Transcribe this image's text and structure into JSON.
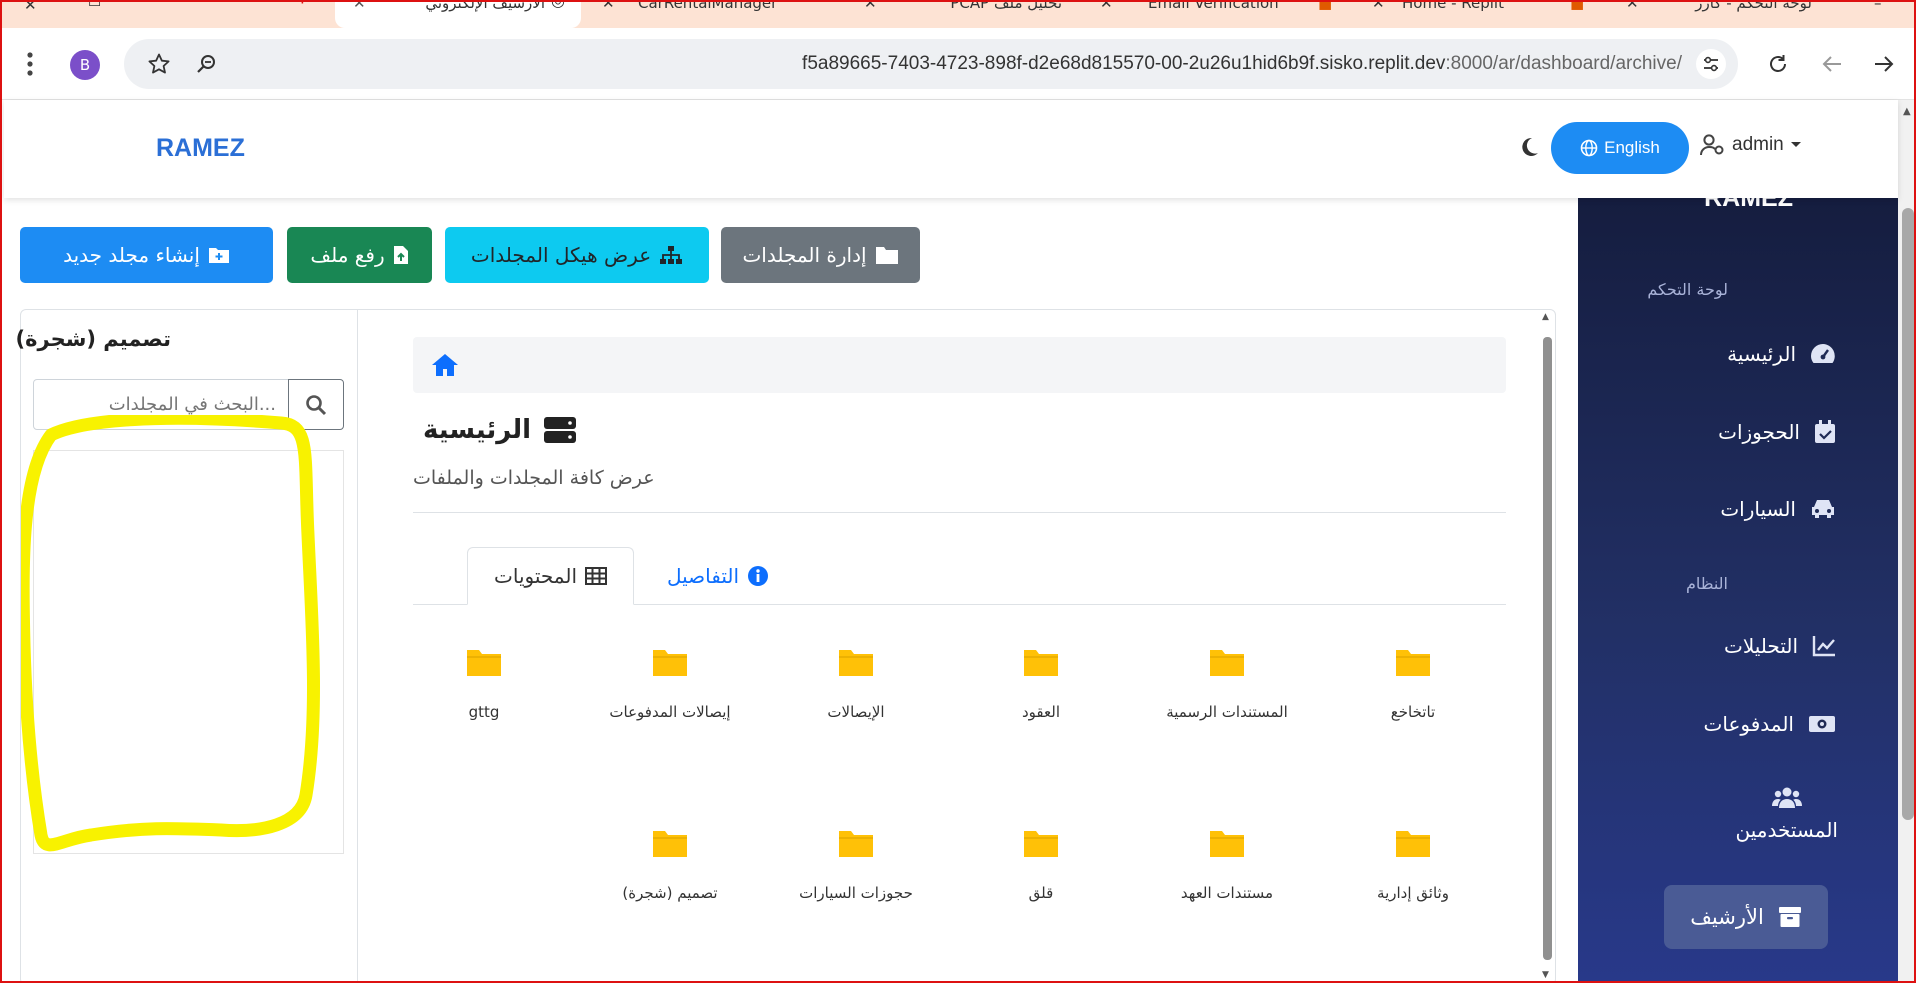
{
  "browser": {
    "tabs": [
      {
        "label": "الأرشيف الإلكتروني",
        "active": true
      },
      {
        "label": "CarRentalManager"
      },
      {
        "label": "تحليل ملف PCAP"
      },
      {
        "label": "Email Verification"
      },
      {
        "label": "Home - Replit"
      },
      {
        "label": "لوحة التحكم - كارز"
      }
    ],
    "profile_initial": "B",
    "url_host": "f5a89665-7403-4723-898f-d2e68d815570-00-2u26u1hid6b9f.sisko.replit.dev",
    "url_rest": ":8000/ar/dashboard/archive/"
  },
  "header": {
    "brand": "RAMEZ",
    "language_button": "English",
    "user_menu": "admin"
  },
  "sidebar": {
    "brand": "RAMEZ",
    "section_dashboard": "لوحة التحكم",
    "section_system": "النظام",
    "items": [
      {
        "label": "الرئيسية",
        "icon": "gauge-icon"
      },
      {
        "label": "الحجوزات",
        "icon": "calendar-check-icon"
      },
      {
        "label": "السيارات",
        "icon": "car-icon"
      },
      {
        "label": "التحليلات",
        "icon": "chart-line-icon"
      },
      {
        "label": "المدفوعات",
        "icon": "money-icon"
      },
      {
        "label": "المستخدمين",
        "icon": "users-icon"
      },
      {
        "label": "الأرشيف",
        "icon": "archive-icon",
        "active": true
      }
    ]
  },
  "toolbar": {
    "new_folder": "إنشاء مجلد جديد",
    "upload_file": "رفع ملف",
    "folder_structure": "عرض هيكل المجلدات",
    "manage_folders": "إدارة المجلدات"
  },
  "tree_panel": {
    "title": "تصميم (شجرة)",
    "search_placeholder": "...البحث في المجلدات"
  },
  "content": {
    "title": "الرئيسية",
    "subtitle": "عرض كافة المجلدات والملفات",
    "tab_contents": "المحتويات",
    "tab_details": "التفاصيل",
    "folders": [
      "تاتخاخع",
      "المستندات الرسمية",
      "العقود",
      "الإيصالات",
      "إيصالات المدفوعات",
      "gttg",
      "وثائق إدارية",
      "مستندات العهد",
      "قلق",
      "حجوزات السيارات",
      "تصميم (شجرة)"
    ]
  },
  "colors": {
    "brand_blue": "#2b6fd6",
    "primary": "#0d6efd",
    "success": "#198754",
    "info": "#0dcaf0",
    "secondary": "#6c757d",
    "folder": "#ffc107",
    "highlight": "#ffff00",
    "sidebar_bg": "#1c2550"
  }
}
